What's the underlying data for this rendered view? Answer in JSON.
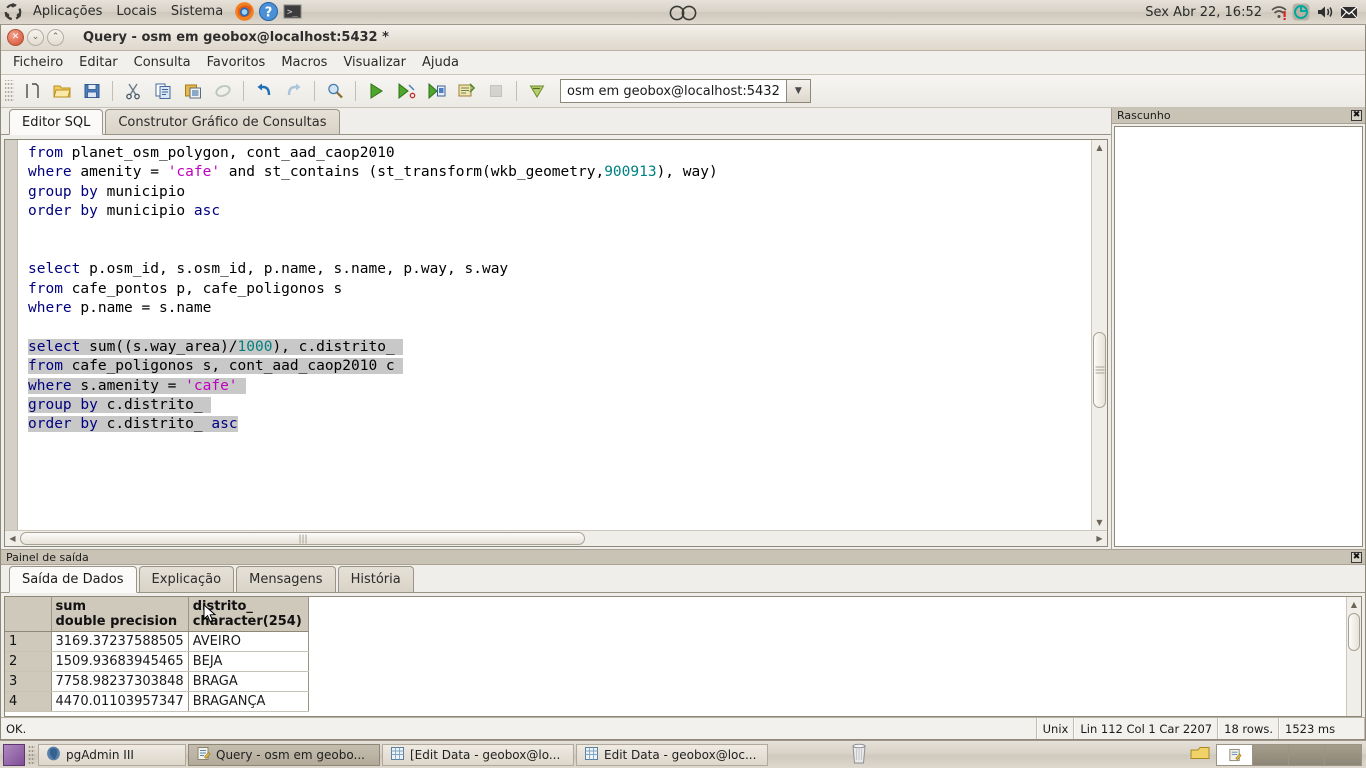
{
  "desktop": {
    "panel_menus": [
      "Aplicações",
      "Locais",
      "Sistema"
    ],
    "panel_icons": [
      "firefox-icon",
      "help-icon",
      "terminal-icon"
    ],
    "clock": "Sex Abr 22, 16:52",
    "tray_icons": [
      "network-icon",
      "update-icon",
      "volume-icon",
      "mail-icon"
    ]
  },
  "window": {
    "title": "Query - osm em geobox@localhost:5432 *",
    "buttons": {
      "close": "close-button",
      "minimize": "minimize-button",
      "maximize": "maximize-button"
    }
  },
  "menubar": {
    "items": [
      "Ficheiro",
      "Editar",
      "Consulta",
      "Favoritos",
      "Macros",
      "Visualizar",
      "Ajuda"
    ]
  },
  "toolbar": {
    "icons": [
      "new-query-icon",
      "open-file-icon",
      "save-file-icon",
      "cut-icon",
      "copy-icon",
      "paste-icon",
      "clear-window-icon",
      "undo-icon",
      "redo-icon",
      "find-replace-icon",
      "execute-query-icon",
      "explain-query-icon",
      "execute-to-file-icon",
      "explain-options-icon",
      "cancel-query-icon",
      "macros-icon"
    ],
    "connection": "osm em geobox@localhost:5432",
    "connection_arrow": "chevron-down-icon"
  },
  "editor": {
    "tabs": [
      {
        "label": "Editor SQL",
        "active": true
      },
      {
        "label": "Construtor Gráfico de Consultas",
        "active": false
      }
    ],
    "lines": [
      {
        "parts": [
          {
            "t": "from",
            "c": "kw"
          },
          {
            "t": " planet_osm_polygon, cont_aad_caop2010",
            "c": ""
          }
        ]
      },
      {
        "parts": [
          {
            "t": "where",
            "c": "kw"
          },
          {
            "t": " amenity = ",
            "c": ""
          },
          {
            "t": "'cafe'",
            "c": "str"
          },
          {
            "t": " and st_contains (st_transform(wkb_geometry,",
            "c": ""
          },
          {
            "t": "900913",
            "c": "num"
          },
          {
            "t": "), way)",
            "c": ""
          }
        ]
      },
      {
        "parts": [
          {
            "t": "group",
            "c": "kw"
          },
          {
            "t": " ",
            "c": ""
          },
          {
            "t": "by",
            "c": "kw"
          },
          {
            "t": " municipio",
            "c": ""
          }
        ]
      },
      {
        "parts": [
          {
            "t": "order",
            "c": "kw"
          },
          {
            "t": " ",
            "c": ""
          },
          {
            "t": "by",
            "c": "kw"
          },
          {
            "t": " municipio ",
            "c": ""
          },
          {
            "t": "asc",
            "c": "kw"
          }
        ]
      },
      {
        "parts": []
      },
      {
        "parts": []
      },
      {
        "parts": [
          {
            "t": "select",
            "c": "kw"
          },
          {
            "t": " p.osm_id, s.osm_id, p.name, s.name, p.way, s.way",
            "c": ""
          }
        ]
      },
      {
        "parts": [
          {
            "t": "from",
            "c": "kw"
          },
          {
            "t": " cafe_pontos p, cafe_poligonos s",
            "c": ""
          }
        ]
      },
      {
        "parts": [
          {
            "t": "where",
            "c": "kw"
          },
          {
            "t": " p.name = s.name",
            "c": ""
          }
        ]
      },
      {
        "parts": []
      },
      {
        "selected": true,
        "parts": [
          {
            "t": "select",
            "c": "kw"
          },
          {
            "t": " sum((s.way_area)/",
            "c": ""
          },
          {
            "t": "1000",
            "c": "num"
          },
          {
            "t": "), c.distrito_ ",
            "c": ""
          }
        ]
      },
      {
        "selected": true,
        "parts": [
          {
            "t": "from",
            "c": "kw"
          },
          {
            "t": " cafe_poligonos s, cont_aad_caop2010 c ",
            "c": ""
          }
        ]
      },
      {
        "selected": true,
        "parts": [
          {
            "t": "where",
            "c": "kw"
          },
          {
            "t": " s.amenity = ",
            "c": ""
          },
          {
            "t": "'cafe'",
            "c": "str"
          },
          {
            "t": " ",
            "c": ""
          }
        ]
      },
      {
        "selected": true,
        "parts": [
          {
            "t": "group",
            "c": "kw"
          },
          {
            "t": " ",
            "c": ""
          },
          {
            "t": "by",
            "c": "kw"
          },
          {
            "t": " c.distrito_ ",
            "c": ""
          }
        ]
      },
      {
        "selected": true,
        "parts": [
          {
            "t": "order",
            "c": "kw"
          },
          {
            "t": " ",
            "c": ""
          },
          {
            "t": "by",
            "c": "kw"
          },
          {
            "t": " c.distrito_ ",
            "c": ""
          },
          {
            "t": "asc",
            "c": "kw"
          }
        ]
      }
    ]
  },
  "rascunho": {
    "title": "Rascunho",
    "close_icon": "close-panel-icon",
    "content": ""
  },
  "output": {
    "title": "Painel de saída",
    "close_icon": "close-panel-icon",
    "tabs": [
      {
        "label": "Saída de Dados",
        "active": true
      },
      {
        "label": "Explicação",
        "active": false
      },
      {
        "label": "Mensagens",
        "active": false
      },
      {
        "label": "História",
        "active": false
      }
    ],
    "grid": {
      "columns": [
        {
          "name": "sum",
          "type": "double precision"
        },
        {
          "name": "distrito_",
          "type": "character(254)"
        }
      ],
      "rows": [
        {
          "n": "1",
          "sum": "3169.37237588505",
          "distrito": "AVEIRO"
        },
        {
          "n": "2",
          "sum": "1509.93683945465",
          "distrito": "BEJA"
        },
        {
          "n": "3",
          "sum": "7758.98237303848",
          "distrito": "BRAGA"
        },
        {
          "n": "4",
          "sum": "4470.01103957347",
          "distrito": "BRAGANÇA"
        }
      ]
    }
  },
  "statusbar": {
    "message": "OK.",
    "line_ending": "Unix",
    "position": "Lin 112 Col 1 Car 2207",
    "rows": "18 rows.",
    "time": "1523 ms"
  },
  "taskbar": {
    "show_desktop": "show-desktop-button",
    "tasks": [
      {
        "label": "pgAdmin III",
        "icon": "pgadmin-icon",
        "active": false
      },
      {
        "label": "Query - osm em geobo...",
        "icon": "query-icon",
        "active": true
      },
      {
        "label": "[Edit Data - geobox@lo...",
        "icon": "editdata-icon",
        "active": false
      },
      {
        "label": "Edit Data - geobox@loc...",
        "icon": "editdata-icon",
        "active": false
      }
    ],
    "trash": "trash-icon",
    "workspaces": [
      {
        "active": false
      },
      {
        "active": true
      },
      {
        "active": false
      },
      {
        "active": false
      }
    ]
  },
  "colors": {
    "keyword": "#00007f",
    "string": "#c000c0",
    "number": "#008080",
    "selection": "#c8c8c8",
    "panel_header": "#c9c3b6"
  }
}
